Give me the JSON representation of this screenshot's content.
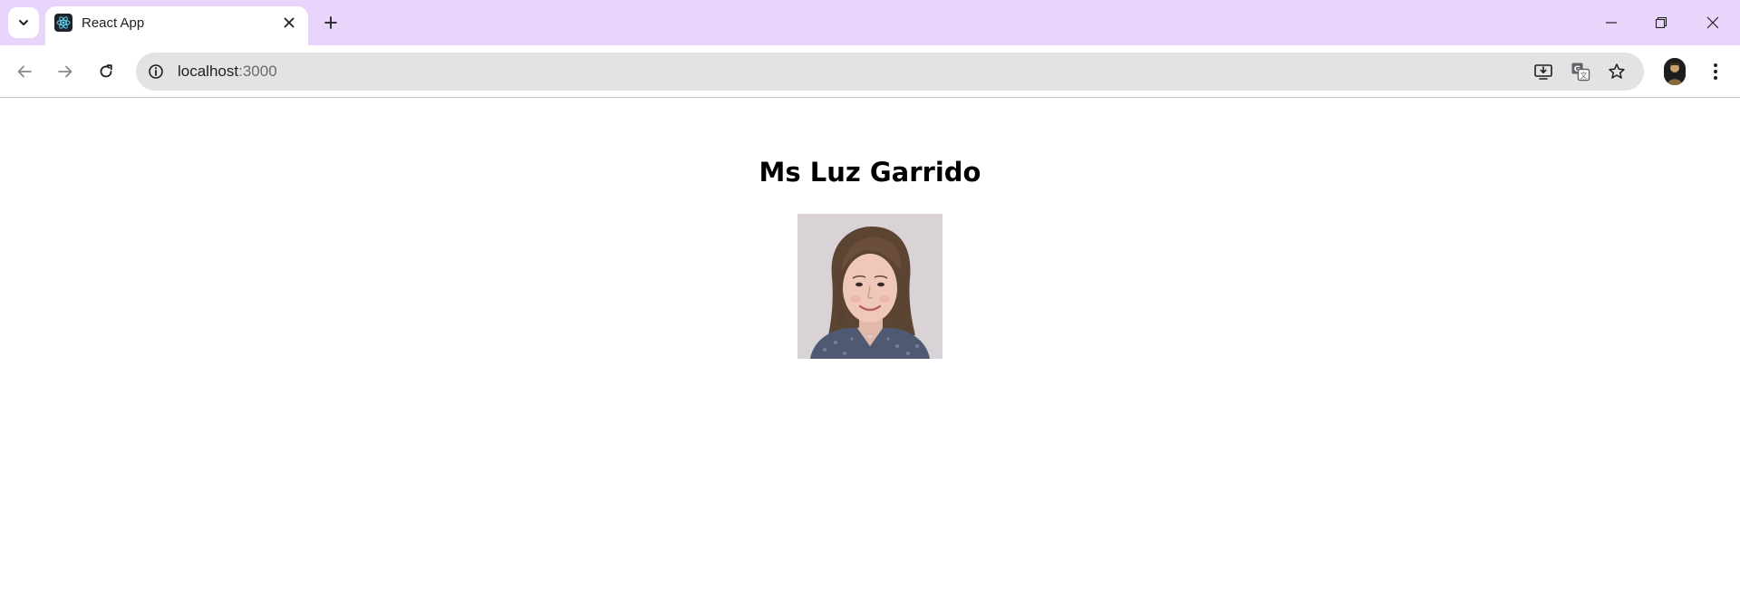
{
  "browser": {
    "tab": {
      "title": "React App"
    },
    "address_bar": {
      "host": "localhost",
      "port": ":3000"
    }
  },
  "profile": {
    "name": "Ms Luz Garrido"
  },
  "colors": {
    "tabstrip": "#e9d5fb",
    "omnibox": "#e3e3e3",
    "react_logo": "#61dafb"
  },
  "icons": {
    "tab_search": "chevron-down-icon",
    "favicon": "react-logo-icon",
    "close_tab": "close-icon",
    "new_tab": "plus-icon",
    "back": "arrow-left-icon",
    "forward": "arrow-right-icon",
    "reload": "reload-icon",
    "site_info": "info-icon",
    "install": "install-app-icon",
    "translate": "translate-icon",
    "bookmark": "star-icon",
    "menu": "kebab-menu-icon"
  }
}
